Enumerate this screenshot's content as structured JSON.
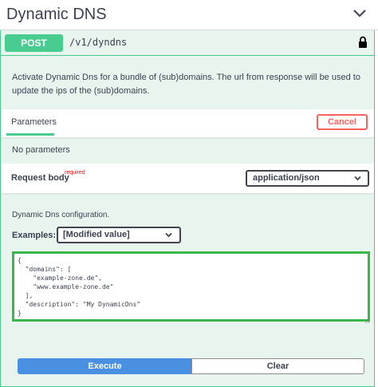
{
  "tag": {
    "title": "Dynamic DNS",
    "toggle_icon": "chevron-down-icon"
  },
  "operation": {
    "method": "POST",
    "path": "/v1/dyndns",
    "lock_icon": "lock-icon",
    "description": "Activate Dynamic Dns for a bundle of (sub)domains. The url from response will be used to update the ips of the (sub)domains."
  },
  "parameters": {
    "tab_label": "Parameters",
    "cancel_label": "Cancel",
    "empty_text": "No parameters"
  },
  "request_body": {
    "title": "Request body",
    "required_label": "required",
    "content_type": "application/json",
    "description": "Dynamic Dns configuration.",
    "examples_label": "Examples:",
    "example_value": "[Modified value]",
    "editor_value": "{\n  \"domains\": [\n    \"example-zone.de\",\n    \"www.example-zone.de\"\n  ],\n  \"description\": \"My DynamicDns\"\n}"
  },
  "actions": {
    "execute_label": "Execute",
    "clear_label": "Clear"
  },
  "colors": {
    "post_accent": "#49cc90",
    "post_background": "#e8f5ee",
    "cancel": "#ff6060",
    "execute": "#4990e2",
    "editor_border": "#3ab64a",
    "required": "#ff0000"
  }
}
